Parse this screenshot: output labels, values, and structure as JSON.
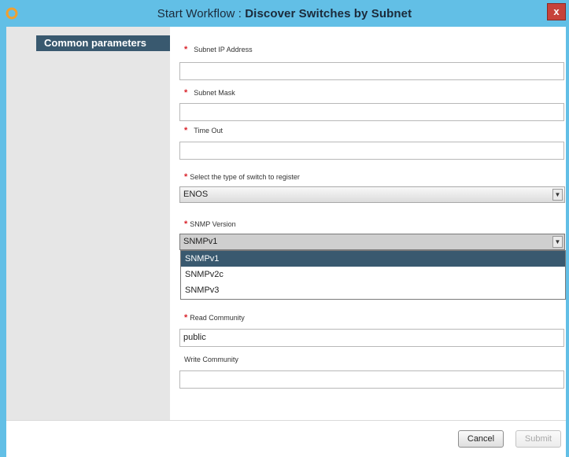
{
  "window": {
    "title_prefix": "Start Workflow : ",
    "title_name": "Discover Switches by Subnet",
    "close_label": "x"
  },
  "sidebar": {
    "section_label": "Common parameters"
  },
  "form": {
    "subnet_ip": {
      "label": "Subnet IP Address",
      "required": "*",
      "value": ""
    },
    "subnet_mask": {
      "label": "Subnet Mask",
      "required": "*",
      "value": ""
    },
    "time_out": {
      "label": "Time Out",
      "required": "*",
      "value": ""
    },
    "switch_type": {
      "label": "Select the type of switch to register",
      "required": "*",
      "value": "ENOS"
    },
    "snmp_version": {
      "label": "SNMP Version",
      "required": "*",
      "value": "SNMPv1",
      "options": [
        "SNMPv1",
        "SNMPv2c",
        "SNMPv3"
      ]
    },
    "read_community": {
      "label": "Read Community",
      "required": "*",
      "value": "public"
    },
    "write_community": {
      "label": "Write Community",
      "value": ""
    }
  },
  "footer": {
    "cancel_label": "Cancel",
    "submit_label": "Submit"
  },
  "icons": {
    "app": "workflow-gear-icon",
    "close": "close-icon",
    "dropdown_arrow": "chevron-down-icon"
  },
  "colors": {
    "titlebar": "#62bfe6",
    "accent": "#39596f",
    "required": "#d9222a"
  }
}
